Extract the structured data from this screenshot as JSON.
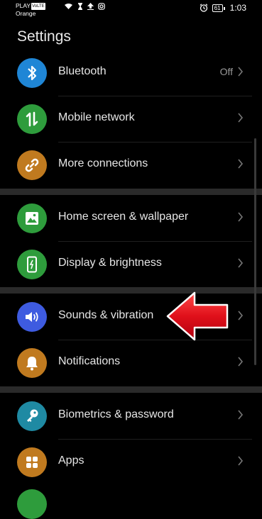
{
  "status_bar": {
    "carrier_top": "PLAY",
    "volte_badge": "VoLTE",
    "carrier_bottom": "Orange",
    "battery": "61",
    "time": "1:03"
  },
  "page_title": "Settings",
  "items": [
    {
      "label": "Bluetooth",
      "value": "Off",
      "icon": "bluetooth-icon",
      "color": "#1f86d6"
    },
    {
      "label": "Mobile network",
      "value": "",
      "icon": "mobile-data-icon",
      "color": "#2e9c3c"
    },
    {
      "label": "More connections",
      "value": "",
      "icon": "link-icon",
      "color": "#c07a1f"
    },
    {
      "label": "Home screen & wallpaper",
      "value": "",
      "icon": "image-icon",
      "color": "#2e9c3c"
    },
    {
      "label": "Display & brightness",
      "value": "",
      "icon": "phone-brightness-icon",
      "color": "#2e9c3c"
    },
    {
      "label": "Sounds & vibration",
      "value": "",
      "icon": "speaker-icon",
      "color": "#3e5be0"
    },
    {
      "label": "Notifications",
      "value": "",
      "icon": "bell-icon",
      "color": "#c07a1f"
    },
    {
      "label": "Biometrics & password",
      "value": "",
      "icon": "key-icon",
      "color": "#1f8aa3"
    },
    {
      "label": "Apps",
      "value": "",
      "icon": "apps-grid-icon",
      "color": "#c07a1f"
    }
  ],
  "annotation": {
    "color": "#e0101a"
  }
}
